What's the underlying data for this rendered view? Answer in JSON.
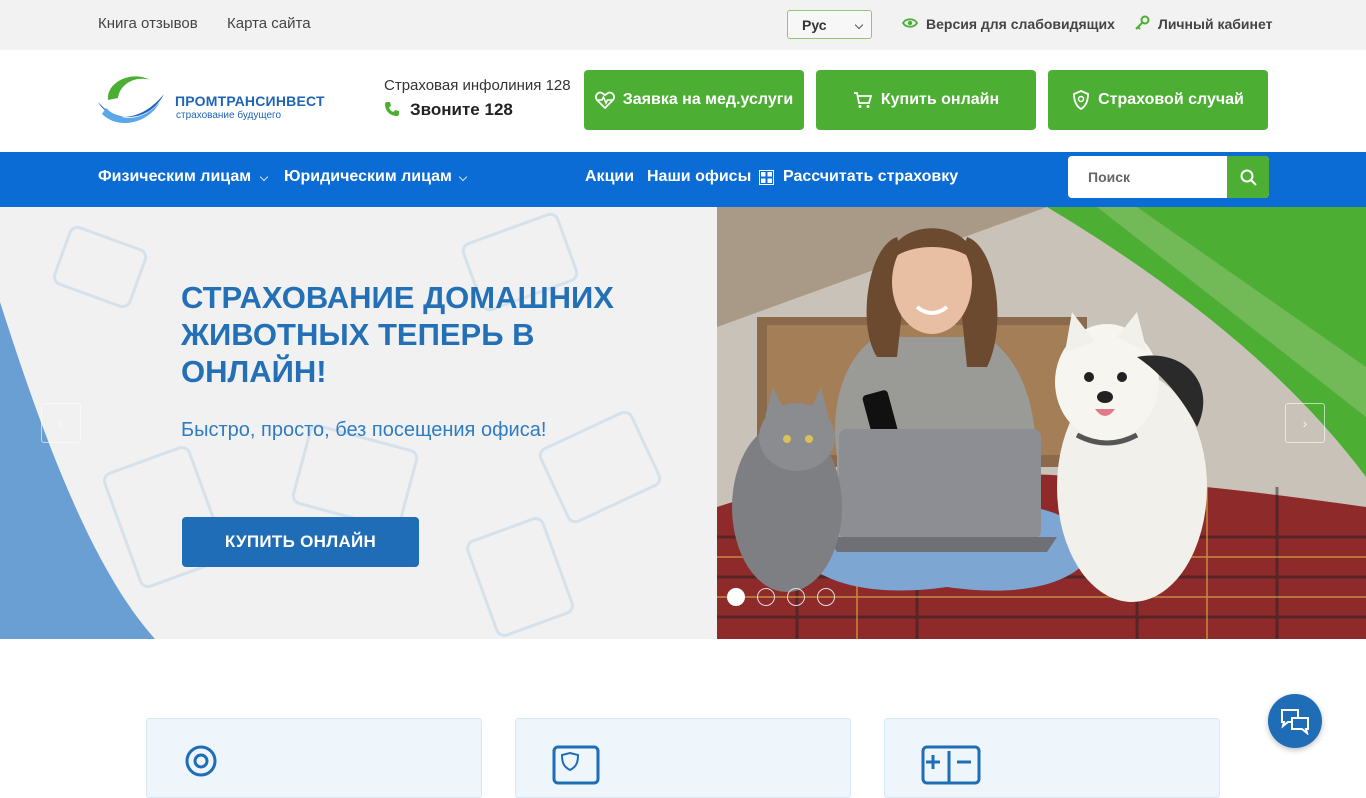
{
  "topbar": {
    "links": [
      "Книга отзывов",
      "Карта сайта"
    ],
    "language": "Рус",
    "accessibility": "Версия для слабовидящих",
    "cabinet": "Личный кабинет"
  },
  "header": {
    "logo_name": "ПРОМТРАНСИНВЕСТ",
    "logo_tagline": "страхование будущего",
    "hotline": "Страховая инфолиния 128",
    "phone": "Звоните 128",
    "buttons": [
      "Заявка на мед.услуги",
      "Купить онлайн",
      "Страховой случай"
    ]
  },
  "nav": {
    "items": [
      "Физическим лицам",
      "Юридическим лицам",
      "Акции",
      "Наши офисы",
      "Рассчитать страховку"
    ],
    "search_placeholder": "Поиск"
  },
  "hero": {
    "title": "СТРАХОВАНИЕ ДОМАШНИХ ЖИВОТНЫХ ТЕПЕРЬ В ОНЛАЙН!",
    "subtitle": "Быстро, просто, без посещения офиса!",
    "button": "КУПИТЬ ОНЛАЙН",
    "slide_count": 4,
    "active_slide": 1
  },
  "colors": {
    "nav_blue": "#0a6cd4",
    "brand_green": "#4caf33",
    "hero_blue": "#2470b6",
    "topbar_bg": "#f2f2f2"
  },
  "icons": [
    "eye-icon",
    "key-icon",
    "phone-icon",
    "heartbeat-icon",
    "cart-icon",
    "shield-icon",
    "calculator-icon",
    "search-icon",
    "chat-icon"
  ]
}
